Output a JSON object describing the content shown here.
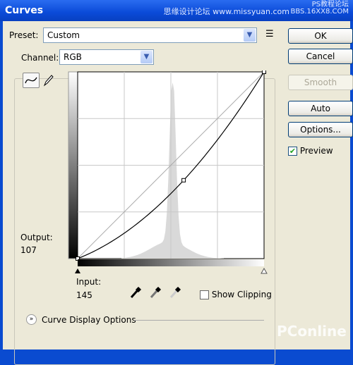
{
  "window": {
    "title": "Curves",
    "watermark_top": "思缘设计论坛 www.missyuan.com",
    "watermark_right": "PS教程论坛 BBS.16XX8.COM",
    "watermark_bottom": "PConline 太平洋电脑网"
  },
  "preset": {
    "label": "Preset:",
    "value": "Custom",
    "menu_icon": "list-menu-icon"
  },
  "channel": {
    "label": "Channel:",
    "value": "RGB"
  },
  "buttons": {
    "ok": "OK",
    "cancel": "Cancel",
    "smooth": "Smooth",
    "auto": "Auto",
    "options": "Options..."
  },
  "preview": {
    "label": "Preview",
    "checked": true
  },
  "curve": {
    "output_label": "Output:",
    "output_value": "107",
    "input_label": "Input:",
    "input_value": "145",
    "points": [
      [
        0,
        0
      ],
      [
        145,
        107
      ],
      [
        255,
        255
      ]
    ]
  },
  "show_clipping": {
    "label": "Show Clipping",
    "checked": false
  },
  "display_options": {
    "label": "Curve Display Options"
  },
  "tools": [
    "curve-point-tool",
    "pencil-tool"
  ],
  "eyedroppers": [
    "black-point-eyedropper",
    "gray-point-eyedropper",
    "white-point-eyedropper"
  ]
}
